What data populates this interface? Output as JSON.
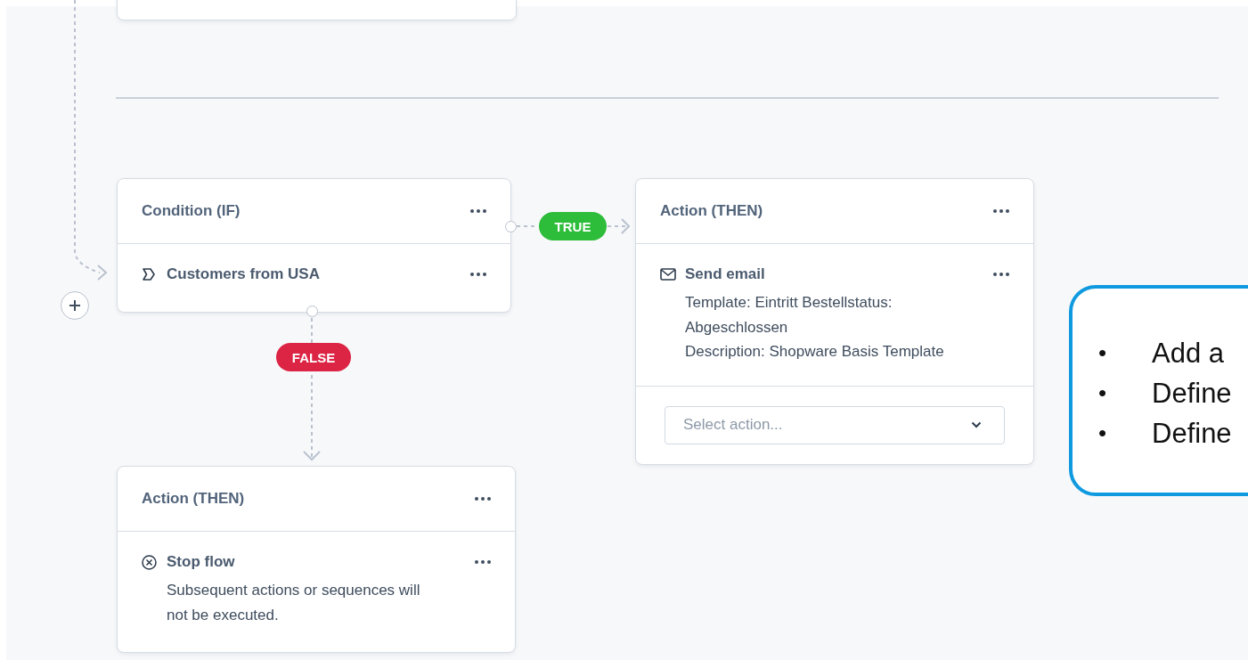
{
  "nodes": [
    {
      "title": "Condition (IF)",
      "items": [
        {
          "kind": "rule",
          "label": "Customers from USA"
        }
      ]
    },
    {
      "title": "Action (THEN)",
      "items": [
        {
          "kind": "email",
          "label": "Send email",
          "description": [
            "Template: Eintritt Bestellstatus: Abgeschlossen",
            "Description: Shopware Basis Template"
          ]
        }
      ],
      "select": {
        "placeholder": "Select action..."
      }
    },
    {
      "title": "Action (THEN)",
      "items": [
        {
          "kind": "stop",
          "label": "Stop flow",
          "description": [
            "Subsequent actions or sequences will not be executed."
          ]
        }
      ]
    }
  ],
  "branches": [
    {
      "kind": "true",
      "label": "TRUE"
    },
    {
      "kind": "false",
      "label": "FALSE"
    }
  ],
  "callout": {
    "items": [
      {
        "bullet": "•",
        "text": "Add a"
      },
      {
        "bullet": "•",
        "text": "Define"
      },
      {
        "bullet": "•",
        "text": "Define"
      }
    ]
  }
}
